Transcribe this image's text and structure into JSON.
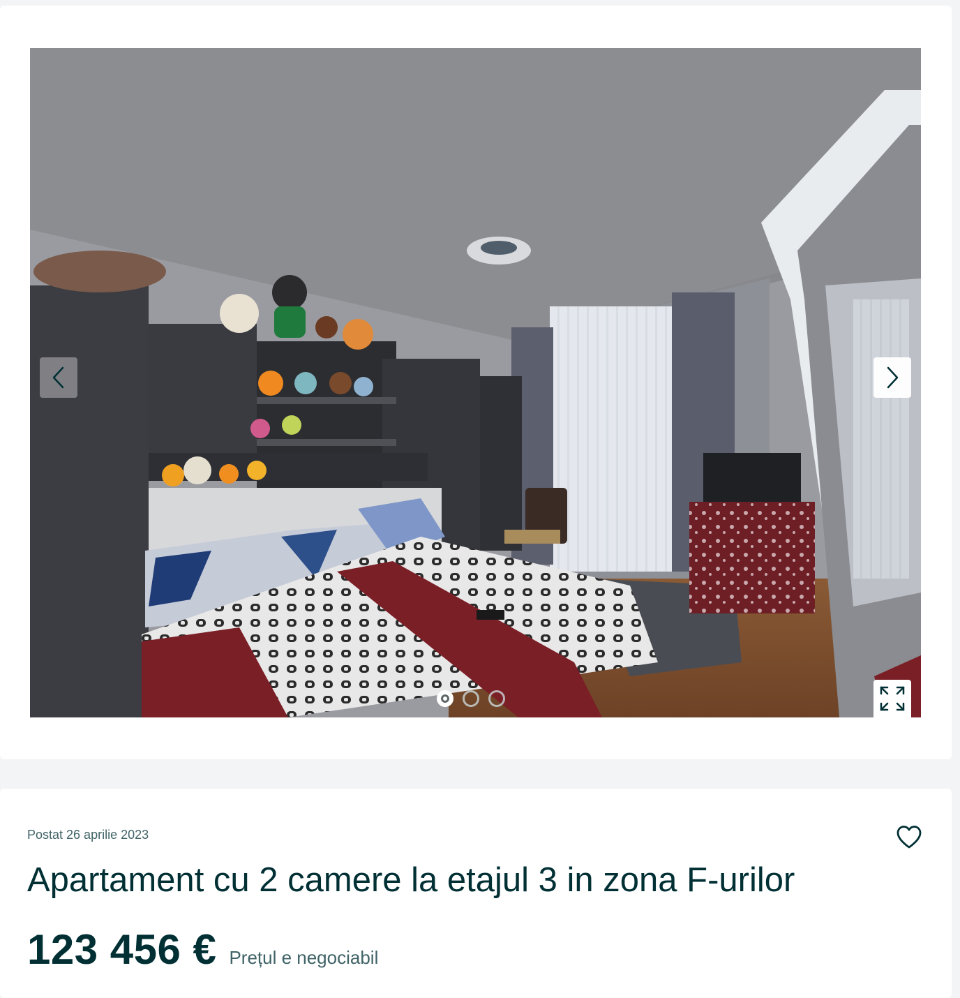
{
  "gallery": {
    "photo_alt": "bedroom",
    "prev_icon": "chevron-left-icon",
    "next_icon": "chevron-right-icon",
    "fullscreen_icon": "expand-icon",
    "dots": [
      {
        "state": "active"
      },
      {
        "state": "inactive"
      },
      {
        "state": "inactive"
      }
    ]
  },
  "listing": {
    "posted": "Postat 26 aprilie 2023",
    "title": "Apartament cu 2 camere la etajul 3 in zona F-urilor",
    "price": "123 456 €",
    "price_note": "Prețul e negociabil",
    "favorite_icon": "heart-icon"
  },
  "colors": {
    "text_primary": "#002f34",
    "text_secondary": "#406367",
    "page_background": "#f2f4f5"
  }
}
